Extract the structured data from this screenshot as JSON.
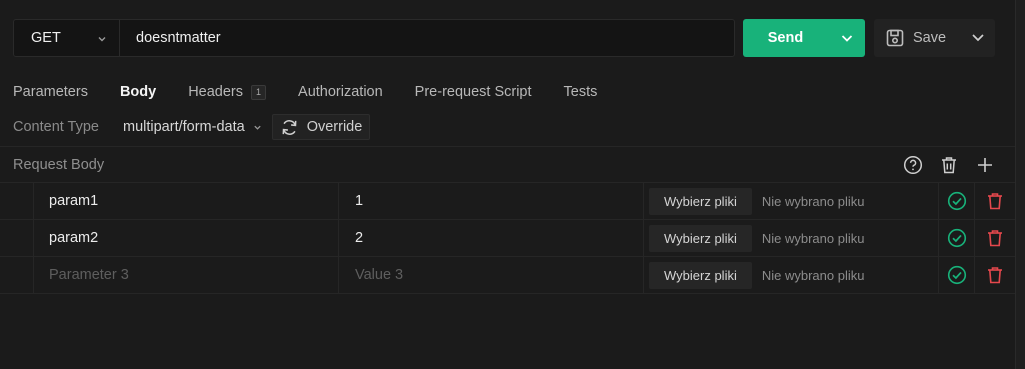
{
  "request": {
    "method": "GET",
    "url": "doesntmatter"
  },
  "actions": {
    "send_label": "Send",
    "save_label": "Save"
  },
  "tabs": [
    {
      "label": "Parameters",
      "active": false
    },
    {
      "label": "Body",
      "active": true
    },
    {
      "label": "Headers",
      "active": false,
      "count": "1"
    },
    {
      "label": "Authorization",
      "active": false
    },
    {
      "label": "Pre-request Script",
      "active": false
    },
    {
      "label": "Tests",
      "active": false
    }
  ],
  "content_type": {
    "label": "Content Type",
    "value": "multipart/form-data",
    "override_label": "Override"
  },
  "request_body": {
    "title": "Request Body",
    "rows": [
      {
        "name": "param1",
        "value": "1",
        "file_button": "Wybierz pliki",
        "file_status": "Nie wybrano pliku"
      },
      {
        "name": "param2",
        "value": "2",
        "file_button": "Wybierz pliki",
        "file_status": "Nie wybrano pliku"
      },
      {
        "name": "",
        "value": "",
        "name_placeholder": "Parameter 3",
        "value_placeholder": "Value 3",
        "file_button": "Wybierz pliki",
        "file_status": "Nie wybrano pliku"
      }
    ]
  },
  "colors": {
    "accent": "#18b27a",
    "danger": "#e5484d",
    "background": "#1b1b1b"
  },
  "icons": {
    "method_dropdown": "chevron-down-icon",
    "send_dropdown": "chevron-down-icon",
    "save": "floppy-disk-icon",
    "override": "refresh-icon",
    "help": "help-circle-icon",
    "trash": "trash-icon",
    "add": "plus-icon",
    "enabled": "check-circle-icon",
    "delete": "delete-icon"
  }
}
